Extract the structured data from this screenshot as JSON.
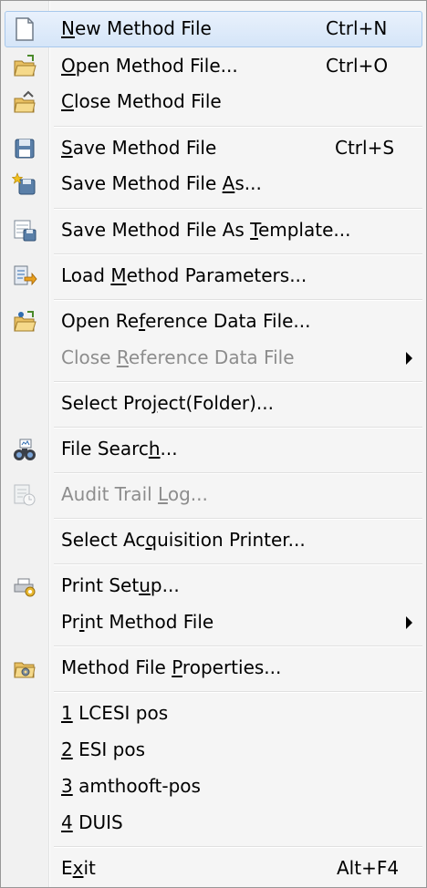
{
  "menu": {
    "items": [
      {
        "pre": "",
        "acc": "N",
        "post": "ew Method File",
        "shortcut": "Ctrl+N",
        "icon": "new-file-icon",
        "disabled": false,
        "submenu": false
      },
      {
        "pre": "",
        "acc": "O",
        "post": "pen Method File...",
        "shortcut": "Ctrl+O",
        "icon": "open-folder-icon",
        "disabled": false,
        "submenu": false
      },
      {
        "pre": "",
        "acc": "C",
        "post": "lose Method File",
        "shortcut": "",
        "icon": "close-folder-icon",
        "disabled": false,
        "submenu": false
      },
      {
        "pre": "",
        "acc": "S",
        "post": "ave Method File",
        "shortcut": "Ctrl+S",
        "icon": "save-icon",
        "disabled": false,
        "submenu": false
      },
      {
        "pre": "Save Method File ",
        "acc": "A",
        "post": "s...",
        "shortcut": "",
        "icon": "save-as-icon",
        "disabled": false,
        "submenu": false
      },
      {
        "pre": "Save Method File As ",
        "acc": "T",
        "post": "emplate...",
        "shortcut": "",
        "icon": "save-template-icon",
        "disabled": false,
        "submenu": false
      },
      {
        "pre": "Load ",
        "acc": "M",
        "post": "ethod Parameters...",
        "shortcut": "",
        "icon": "load-parameters-icon",
        "disabled": false,
        "submenu": false
      },
      {
        "pre": "Open Re",
        "acc": "f",
        "post": "erence Data File...",
        "shortcut": "",
        "icon": "open-reference-icon",
        "disabled": false,
        "submenu": false
      },
      {
        "pre": "Close ",
        "acc": "R",
        "post": "eference Data File",
        "shortcut": "",
        "icon": "",
        "disabled": true,
        "submenu": true
      },
      {
        "pre": "Select Pro",
        "acc": "j",
        "post": "ect(Folder)...",
        "shortcut": "",
        "icon": "",
        "disabled": false,
        "submenu": false
      },
      {
        "pre": "File Searc",
        "acc": "h",
        "post": "...",
        "shortcut": "",
        "icon": "binoculars-icon",
        "disabled": false,
        "submenu": false
      },
      {
        "pre": "Audit Trail ",
        "acc": "L",
        "post": "og...",
        "shortcut": "",
        "icon": "audit-log-icon",
        "disabled": true,
        "submenu": false
      },
      {
        "pre": "Select Ac",
        "acc": "q",
        "post": "uisition Printer...",
        "shortcut": "",
        "icon": "",
        "disabled": false,
        "submenu": false
      },
      {
        "pre": "Print Set",
        "acc": "u",
        "post": "p...",
        "shortcut": "",
        "icon": "printer-setup-icon",
        "disabled": false,
        "submenu": false
      },
      {
        "pre": "Pr",
        "acc": "i",
        "post": "nt Method File",
        "shortcut": "",
        "icon": "",
        "disabled": false,
        "submenu": true
      },
      {
        "pre": "Method File ",
        "acc": "P",
        "post": "roperties...",
        "shortcut": "",
        "icon": "properties-icon",
        "disabled": false,
        "submenu": false
      },
      {
        "pre": "",
        "acc": "1",
        "post": " LCESI pos",
        "shortcut": "",
        "icon": "",
        "disabled": false,
        "submenu": false
      },
      {
        "pre": "",
        "acc": "2",
        "post": " ESI pos",
        "shortcut": "",
        "icon": "",
        "disabled": false,
        "submenu": false
      },
      {
        "pre": "",
        "acc": "3",
        "post": " amthooft-pos",
        "shortcut": "",
        "icon": "",
        "disabled": false,
        "submenu": false
      },
      {
        "pre": "",
        "acc": "4",
        "post": " DUIS",
        "shortcut": "",
        "icon": "",
        "disabled": false,
        "submenu": false
      },
      {
        "pre": "E",
        "acc": "x",
        "post": "it",
        "shortcut": "Alt+F4",
        "icon": "",
        "disabled": false,
        "submenu": false
      }
    ],
    "colors": {
      "highlight": "#d5e5f8",
      "highlight_border": "#a8c8ec",
      "disabled_text": "#8d8d8d"
    }
  }
}
